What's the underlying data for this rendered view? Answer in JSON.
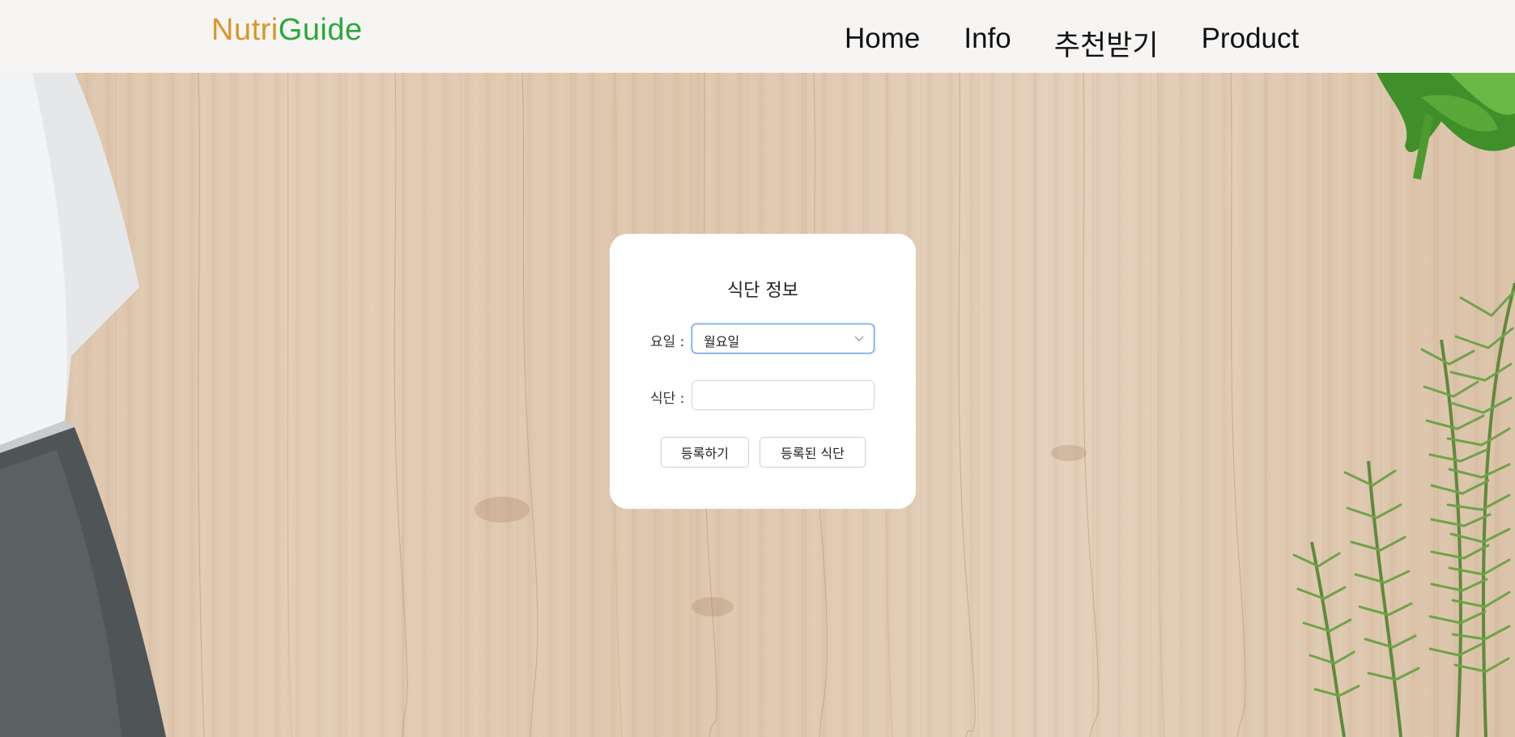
{
  "header": {
    "logo_part1": "Nutri",
    "logo_part2": "Guide",
    "nav": [
      {
        "label": "Home"
      },
      {
        "label": "Info"
      },
      {
        "label": "추천받기"
      },
      {
        "label": "Product"
      }
    ]
  },
  "form": {
    "title": "식단 정보",
    "day_label": "요일 :",
    "day_selected": "월요일",
    "meal_label": "식단 :",
    "meal_value": "",
    "meal_placeholder": "",
    "register_button": "등록하기",
    "registered_button": "등록된 식단"
  },
  "colors": {
    "logo_nutri": "#d9962a",
    "logo_guide": "#2aa83a",
    "header_bg": "#f7f5f3",
    "select_focus_border": "#4a8fe8"
  },
  "icons": {
    "select_arrow": "chevron-down-icon"
  }
}
